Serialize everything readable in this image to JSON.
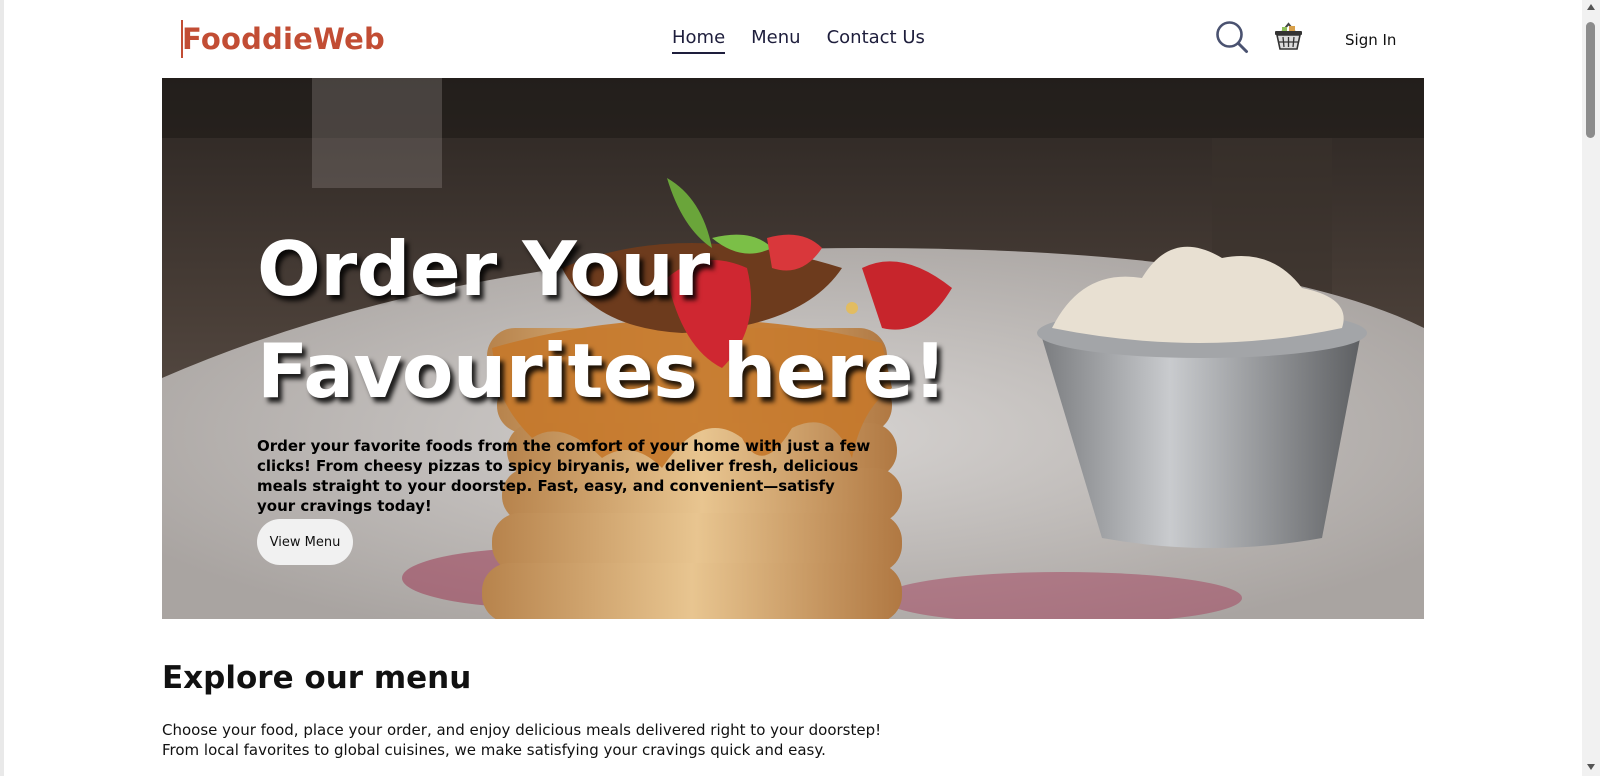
{
  "brand": {
    "name": "FooddieWeb",
    "color": "#c24d34"
  },
  "nav": {
    "links": [
      {
        "label": "Home",
        "active": true
      },
      {
        "label": "Menu",
        "active": false
      },
      {
        "label": "Contact Us",
        "active": false
      }
    ],
    "search_icon": "search-icon",
    "cart_icon": "basket-icon",
    "signin_label": "Sign In"
  },
  "hero": {
    "title_line1": "Order Your",
    "title_line2": "Favourites here!",
    "description": "Order your favorite foods from the comfort of your home with just a few clicks! From cheesy pizzas to spicy biryanis, we deliver fresh, delicious meals straight to your doorstep. Fast, easy, and convenient—satisfy your cravings today!",
    "button_label": "View Menu"
  },
  "explore": {
    "title": "Explore our menu",
    "description": "Choose your food, place your order, and enjoy delicious meals delivered right to your doorstep! From local favorites to global cuisines, we make satisfying your cravings quick and easy."
  }
}
